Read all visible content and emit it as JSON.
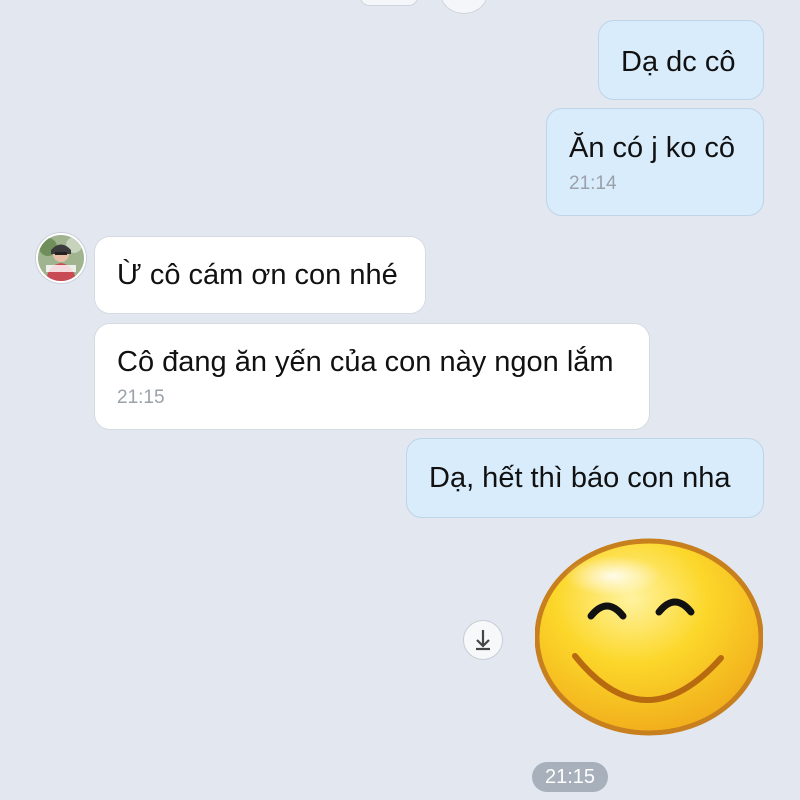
{
  "messages": [
    {
      "text": "Dạ dc cô"
    },
    {
      "text": "Ăn có j ko cô",
      "time": "21:14"
    },
    {
      "text": "Ừ cô cám ơn con nhé"
    },
    {
      "text": "Cô đang ăn yến của con này ngon lắm",
      "time": "21:15"
    },
    {
      "text": "Dạ, hết thì báo con nha"
    }
  ],
  "sticker": {
    "icon": "smiley-sticker"
  },
  "footer": {
    "time": "21:15"
  },
  "colors": {
    "background": "#e3e7ef",
    "outgoing_bubble": "#d9ecfb",
    "incoming_bubble": "#ffffff",
    "time_pill": "#a8b0bc"
  }
}
